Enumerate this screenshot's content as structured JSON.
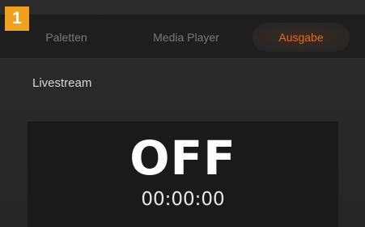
{
  "badge": {
    "number": "1"
  },
  "tabs": [
    {
      "label": "Paletten",
      "active": false
    },
    {
      "label": "Media Player",
      "active": false
    },
    {
      "label": "Ausgabe",
      "active": true
    }
  ],
  "livestream": {
    "label": "Livestream",
    "state": "OFF",
    "timer": "00:00:00"
  },
  "colors": {
    "active_tab": "#e56a1c",
    "badge": "#f0a21e",
    "background": "#262626",
    "display": "#1a1a1a"
  }
}
